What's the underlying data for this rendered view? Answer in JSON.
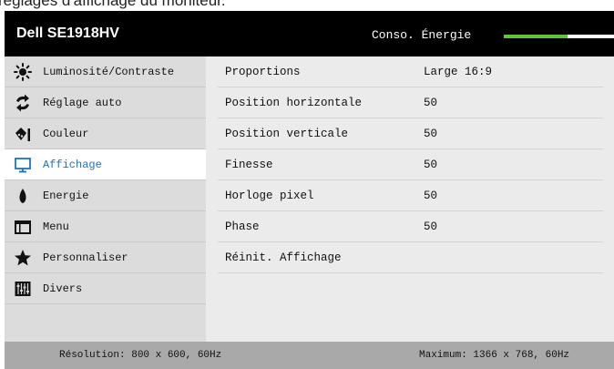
{
  "caption": "réglages d'affichage du moniteur.",
  "header": {
    "brand": "Dell SE1918HV",
    "energy_label": "Conso. Énergie",
    "energy_level_fraction": 0.58,
    "energy_fill_color": "#63c13a"
  },
  "sidebar": {
    "items": [
      {
        "label": "Luminosité/Contraste",
        "icon": "brightness-icon"
      },
      {
        "label": "Réglage auto",
        "icon": "auto-adjust-icon"
      },
      {
        "label": "Couleur",
        "icon": "color-icon"
      },
      {
        "label": "Affichage",
        "icon": "display-icon",
        "active": true
      },
      {
        "label": "Energie",
        "icon": "energy-icon"
      },
      {
        "label": "Menu",
        "icon": "menu-icon"
      },
      {
        "label": "Personnaliser",
        "icon": "star-icon"
      },
      {
        "label": "Divers",
        "icon": "sliders-icon"
      }
    ],
    "active_color": "#1e73be"
  },
  "settings": [
    {
      "label": "Proportions",
      "value": "Large 16:9"
    },
    {
      "label": "Position horizontale",
      "value": "50"
    },
    {
      "label": "Position verticale",
      "value": "50"
    },
    {
      "label": "Finesse",
      "value": "50"
    },
    {
      "label": "Horloge pixel",
      "value": "50"
    },
    {
      "label": "Phase",
      "value": "50"
    },
    {
      "label": "Réinit. Affichage",
      "value": ""
    }
  ],
  "footer": {
    "resolution": "Résolution: 800 x 600, 60Hz",
    "maximum": "Maximum: 1366 x 768, 60Hz"
  }
}
